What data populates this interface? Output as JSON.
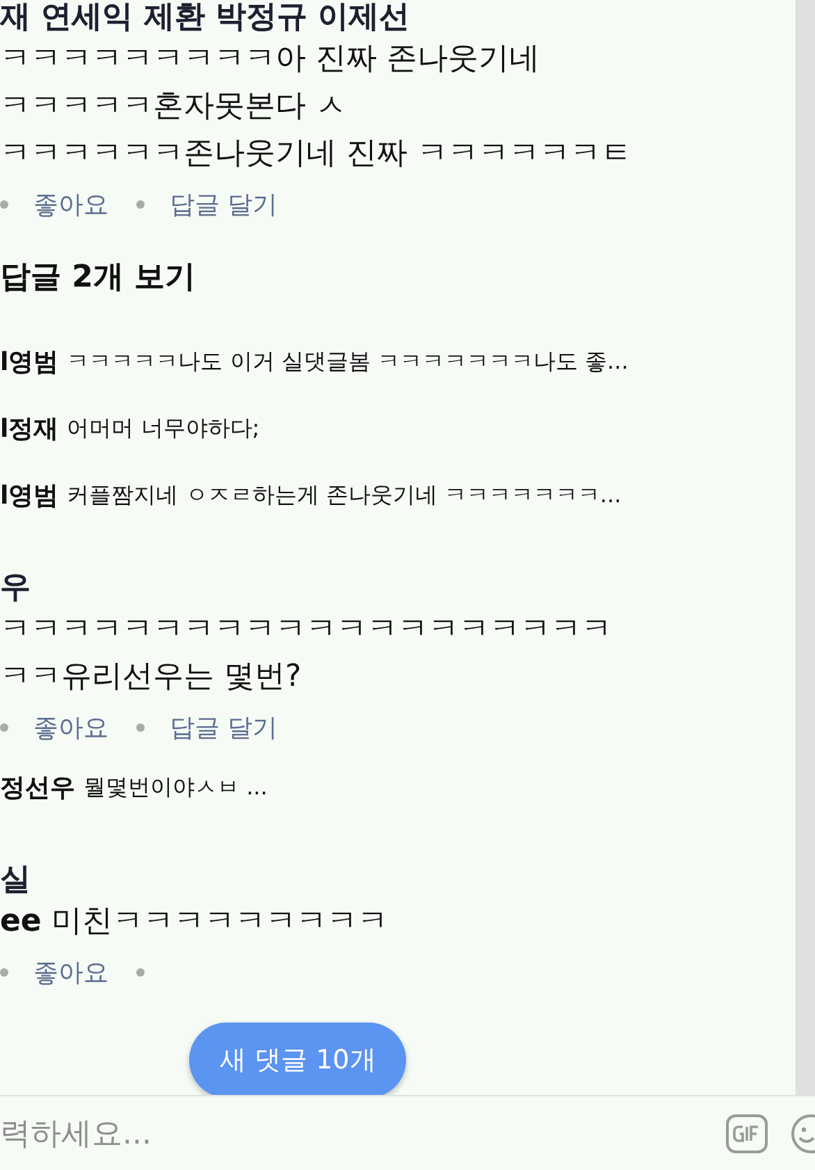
{
  "comments": [
    {
      "author": "재 연세익 제환 박정규 이제선",
      "lines": [
        "ㅋㅋㅋㅋㅋㅋㅋㅋㅋ아 진짜 존나웃기네",
        "ㅋㅋㅋㅋㅋ혼자못본다 ㅅ",
        "ㅋㅋㅋㅋㅋㅋ존나웃기네 진짜 ㅋㅋㅋㅋㅋㅋㅌ"
      ],
      "actions": [
        "좋아요",
        "답글 달기"
      ],
      "actions_cut": false,
      "view_replies": "답글 2개 보기",
      "replies": [
        {
          "name": "l영범",
          "text": "ㅋㅋㅋㅋㅋ나도 이거 실댓글봄 ㅋㅋㅋㅋㅋㅋㅋ나도 좋..."
        },
        {
          "name": "l정재",
          "text": "어머머 너무야하다;"
        },
        {
          "name": "l영범",
          "text": "커플짬지네 ㅇㅈㄹ하는게 존나웃기네 ㅋㅋㅋㅋㅋㅋㅋ..."
        }
      ]
    },
    {
      "author": "우",
      "lines": [
        "ㅋㅋㅋㅋㅋㅋㅋㅋㅋㅋㅋㅋㅋㅋㅋㅋㅋㅋㅋㅋ",
        "ㅋㅋ유리선우는 몇번?"
      ],
      "actions": [
        "좋아요",
        "답글 달기"
      ],
      "actions_cut": false,
      "replies": [
        {
          "name": "정선우",
          "text": "뭘몇번이야ㅅㅂ ..."
        }
      ]
    },
    {
      "author": "실",
      "lines": [
        "**ee** 미친ㅋㅋㅋㅋㅋㅋㅋㅋㅋ"
      ],
      "actions": [
        "좋아요"
      ],
      "actions_cut": true
    }
  ],
  "new_comments_button": "새 댓글 10개",
  "input": {
    "placeholder": "력하세요..."
  }
}
